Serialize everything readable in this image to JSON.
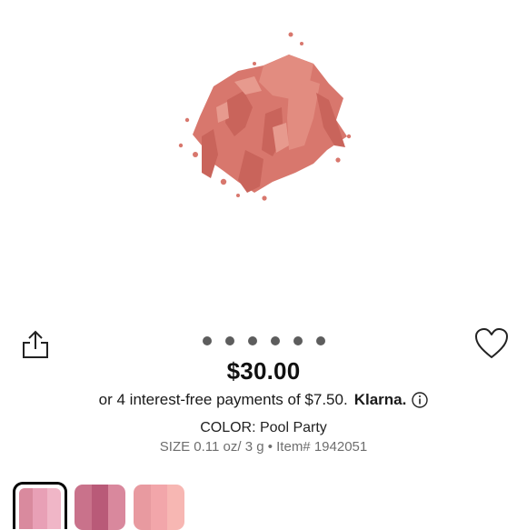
{
  "product": {
    "image_name": "crushed-blush-powder",
    "price": "$30.00",
    "installments_text": "or 4 interest-free payments of $7.50.",
    "installments_provider": "Klarna.",
    "color_line": "COLOR: Pool Party",
    "size_line": "SIZE 0.11 oz/ 3 g • Item# 1942051"
  },
  "carousel": {
    "total": 6
  },
  "swatches": [
    {
      "name": "swatch-1",
      "selected": true,
      "colors": [
        "#d98a9e",
        "#e8a0b6",
        "#f0b6c7"
      ]
    },
    {
      "name": "swatch-2",
      "selected": false,
      "colors": [
        "#c9728b",
        "#b95a78",
        "#d9889d"
      ]
    },
    {
      "name": "swatch-3",
      "selected": false,
      "colors": [
        "#e89aa0",
        "#f2a6aa",
        "#f7b7b3"
      ]
    }
  ],
  "icons": {
    "share": "share-icon",
    "favorite": "heart-icon",
    "info": "info-icon"
  },
  "colors": {
    "blush": "#d97a70",
    "dot": "#5d5d5d"
  }
}
